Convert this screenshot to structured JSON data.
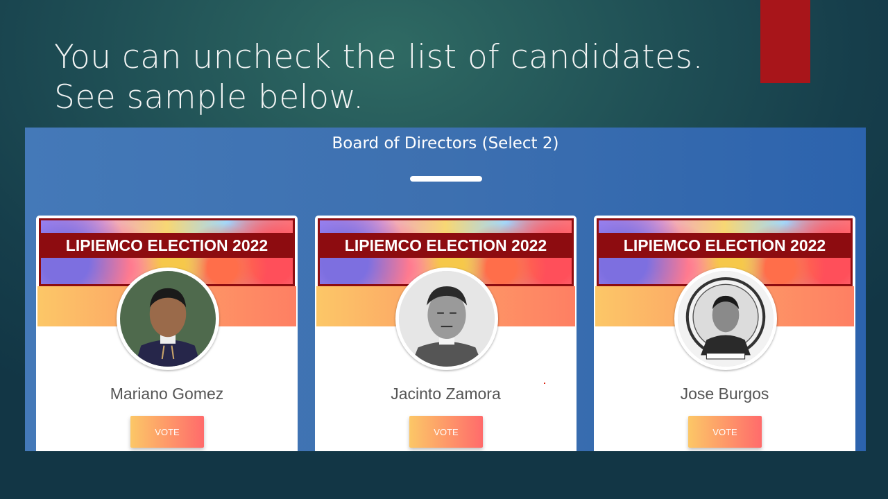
{
  "slide": {
    "title": "You can uncheck the list of candidates. See sample below.",
    "accent_color": "#a8151a"
  },
  "ballot": {
    "position_title": "Board of Directors (Select 2)",
    "banner_text": "LIPIEMCO ELECTION 2022",
    "vote_label": "VOTE",
    "candidates": [
      {
        "name": "Mariano Gomez",
        "photo": "portrait-painting"
      },
      {
        "name": "Jacinto Zamora",
        "photo": "portrait-sketch"
      },
      {
        "name": "Jose Burgos",
        "photo": "portrait-engraving-medallion"
      }
    ]
  },
  "colors": {
    "panel_blue": "#3d70b0",
    "banner_red": "#8d0c10",
    "stripe_gradient": [
      "#fcc767",
      "#fe7f63"
    ]
  }
}
